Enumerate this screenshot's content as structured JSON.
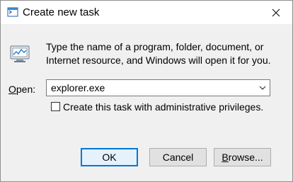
{
  "window": {
    "title": "Create new task",
    "close_glyph": "✕",
    "icon": "run-window-icon"
  },
  "message": {
    "line1": "Type the name of a program, folder, document, or",
    "line2": "Internet resource, and Windows will open it for you.",
    "icon": "task-manager-icon"
  },
  "open_field": {
    "label_mnemonic": "O",
    "label_rest": "pen:",
    "value": "explorer.exe",
    "dropdown_icon": "chevron-down-icon"
  },
  "admin_checkbox": {
    "label": "Create this task with administrative privileges.",
    "checked": false
  },
  "buttons": {
    "ok": "OK",
    "cancel": "Cancel",
    "browse_mnemonic": "B",
    "browse_rest": "rowse..."
  },
  "colors": {
    "default_button_border": "#0078d7",
    "dialog_background": "#f0f0f0"
  }
}
